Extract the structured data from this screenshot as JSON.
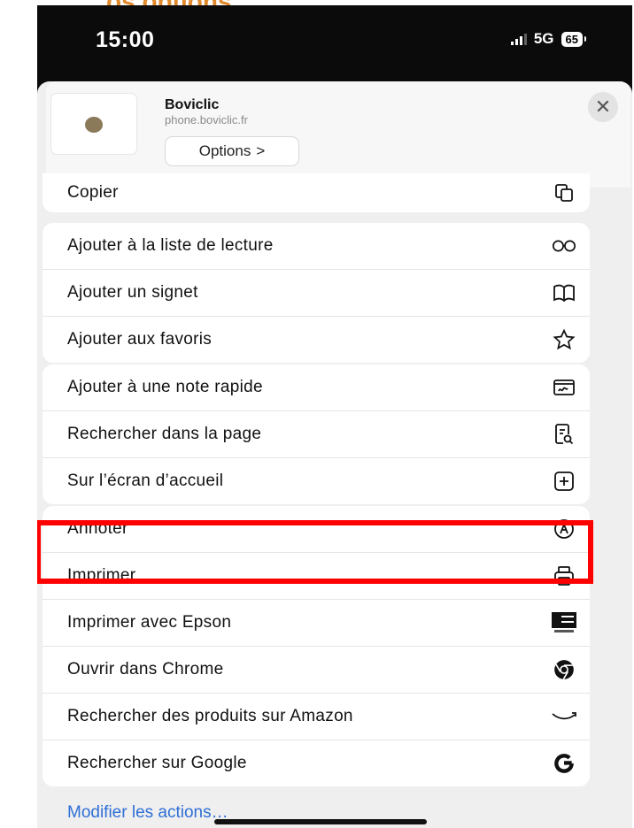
{
  "caption": "os options.",
  "status_bar": {
    "time": "15:00",
    "network": "5G",
    "battery": "65"
  },
  "header": {
    "site_name": "Boviclic",
    "site_url": "phone.boviclic.fr",
    "options_label": "Options",
    "options_chevron": ">",
    "close_label": "✕"
  },
  "rows": {
    "copy": "Copier",
    "reading_list": "Ajouter à la liste de lecture",
    "bookmark": "Ajouter un signet",
    "favorites": "Ajouter aux favoris",
    "quick_note": "Ajouter à une note rapide",
    "find": "Rechercher dans la page",
    "home_screen": "Sur l’écran d’accueil",
    "markup": "Annoter",
    "print": "Imprimer",
    "print_epson": "Imprimer avec Epson",
    "open_chrome": "Ouvrir dans Chrome",
    "amazon": "Rechercher des produits sur Amazon",
    "google": "Rechercher sur Google"
  },
  "footer": {
    "edit_actions": "Modifier les actions…"
  },
  "colors": {
    "highlight": "#ff0000",
    "link": "#2f6fd6"
  },
  "icons": {
    "copy": "copy-icon",
    "reading_list": "glasses-icon",
    "bookmark": "book-icon",
    "favorites": "star-icon",
    "quick_note": "quick-note-icon",
    "find": "find-in-page-icon",
    "home_screen": "add-square-icon",
    "markup": "markup-pen-icon",
    "print": "printer-icon",
    "print_epson": "epson-icon",
    "open_chrome": "chrome-icon",
    "amazon": "amazon-smile-icon",
    "google": "google-g-icon"
  }
}
